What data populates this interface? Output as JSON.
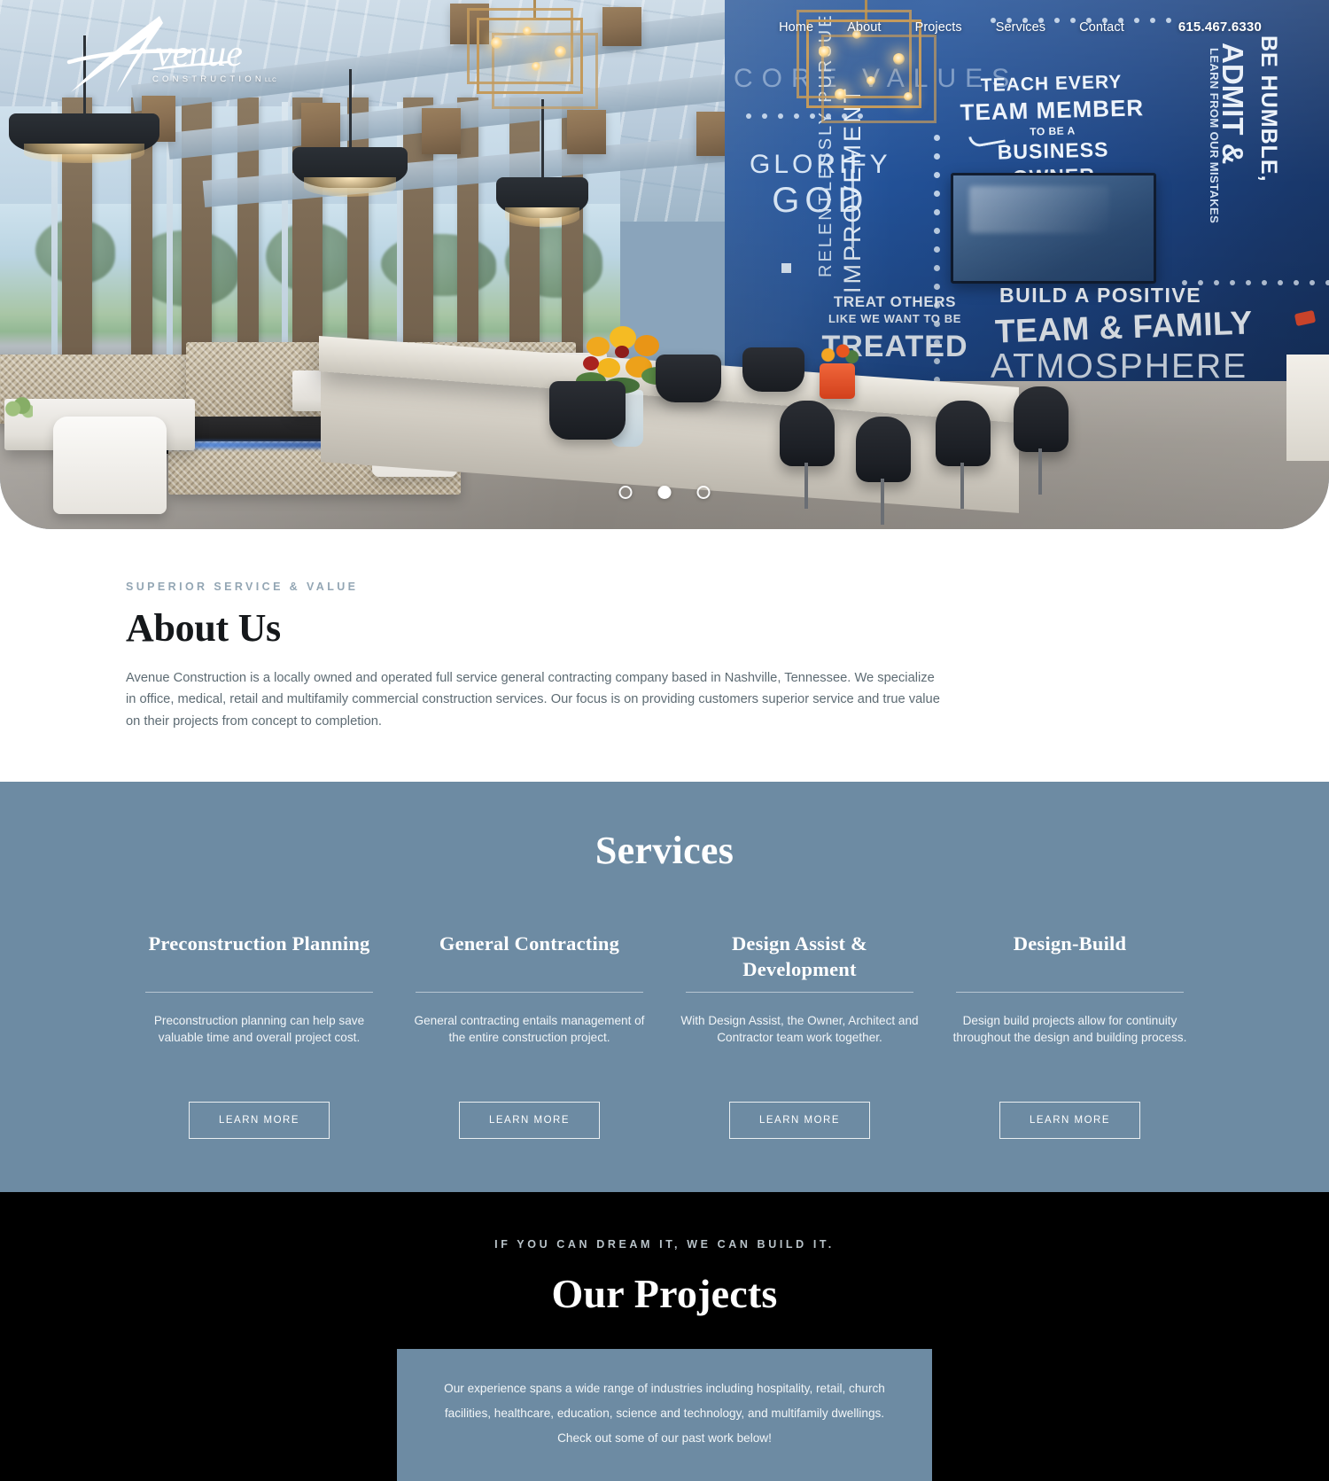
{
  "site": {
    "brand_name": "Avenue",
    "brand_sub": "CONSTRUCTION",
    "brand_sub_suffix": "LLC"
  },
  "nav": {
    "items": [
      {
        "label": "Home"
      },
      {
        "label": "About"
      },
      {
        "label": "Projects"
      },
      {
        "label": "Services"
      },
      {
        "label": "Contact"
      }
    ],
    "phone": "615.467.6330"
  },
  "hero": {
    "carousel": {
      "slides": 3,
      "active_index": 1,
      "dot_labels": [
        "slide-1",
        "slide-2",
        "slide-3"
      ]
    },
    "mural": {
      "core_values": "CORE VALUES",
      "glorify_line1": "GLORIFY",
      "glorify_line2": "GOD",
      "relentless": "RELENTLESSLY PURSUE",
      "improvement": "IMPROVEMENT",
      "teach_line1": "TEACH EVERY",
      "teach_line2": "TEAM MEMBER",
      "teach_line3": "TO BE A",
      "teach_line4": "BUSINESS OWNER",
      "humble": "BE HUMBLE,",
      "admit": "ADMIT &",
      "learn": "LEARN FROM OUR MISTAKES",
      "treat_line1": "TREAT OTHERS",
      "treat_line2": "LIKE WE WANT TO BE",
      "treat_line3": "TREATED",
      "positive": "BUILD A POSITIVE",
      "team_family": "TEAM & FAMILY",
      "atmosphere": "ATMOSPHERE"
    }
  },
  "about": {
    "eyebrow": "Superior Service & Value",
    "title": "About Us",
    "body": "Avenue Construction is a locally owned and operated full service general contracting company based in Nashville, Tennessee. We specialize in office, medical, retail and multifamily commercial construction services. Our focus is on providing customers superior service and true value on their projects from concept to completion."
  },
  "services": {
    "title": "Services",
    "cards": [
      {
        "title": "Preconstruction Planning",
        "body": "Preconstruction planning can help save valuable time and overall project cost.",
        "button": "Learn More"
      },
      {
        "title": "General Contracting",
        "body": "General contracting entails management of the entire construction project.",
        "button": "Learn More"
      },
      {
        "title": "Design Assist & Development",
        "body": "With Design Assist, the Owner, Architect and Contractor team work together.",
        "button": "Learn More"
      },
      {
        "title": "Design-Build",
        "body": "Design build projects allow for continuity throughout the design and building process.",
        "button": "Learn More"
      }
    ]
  },
  "projects": {
    "tagline": "If you can dream it, we can build it.",
    "title": "Our Projects",
    "body": "Our experience spans a wide range of industries including hospitality, retail, church facilities, healthcare, education, science and technology, and multifamily dwellings. Check out some of our past work below!"
  },
  "colors": {
    "slate_blue": "#6d8ba3",
    "mural_blue": "#1f4f93",
    "black": "#000000",
    "eyebrow_gray": "#93a6b4",
    "body_gray": "#5d6b73"
  }
}
